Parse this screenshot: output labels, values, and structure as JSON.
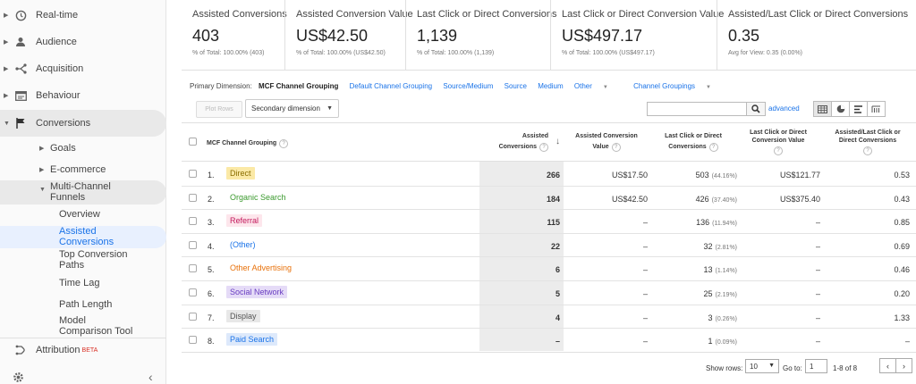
{
  "sidebar": {
    "realtime": "Real-time",
    "audience": "Audience",
    "acquisition": "Acquisition",
    "behaviour": "Behaviour",
    "conversions": "Conversions",
    "goals": "Goals",
    "ecommerce": "E-commerce",
    "mcf": "Multi-Channel Funnels",
    "overview": "Overview",
    "assisted": "Assisted Conversions",
    "top_paths": "Top Conversion Paths",
    "time_lag": "Time Lag",
    "path_length": "Path Length",
    "model_comparison": "Model Comparison Tool",
    "attribution": "Attribution",
    "attribution_badge": "BETA"
  },
  "scorecards": [
    {
      "label": "Assisted Conversions",
      "value": "403",
      "sub": "% of Total: 100.00% (403)"
    },
    {
      "label": "Assisted Conversion Value",
      "value": "US$42.50",
      "sub": "% of Total: 100.00% (US$42.50)"
    },
    {
      "label": "Last Click or Direct Conversions",
      "value": "1,139",
      "sub": "% of Total: 100.00% (1,139)"
    },
    {
      "label": "Last Click or Direct Conversion Value",
      "value": "US$497.17",
      "sub": "% of Total: 100.00% (US$497.17)"
    },
    {
      "label": "Assisted/Last Click or Direct Conversions",
      "value": "0.35",
      "sub": "Avg for View: 0.35 (0.00%)"
    }
  ],
  "dimensions": {
    "label": "Primary Dimension:",
    "current": "MCF Channel Grouping",
    "links": [
      "Default Channel Grouping",
      "Source/Medium",
      "Source",
      "Medium"
    ],
    "other": "Other",
    "channel_groupings": "Channel Groupings"
  },
  "toolbar": {
    "plot_rows": "Plot Rows",
    "secondary_dimension": "Secondary dimension",
    "advanced": "advanced"
  },
  "table": {
    "headers": {
      "channel": "MCF Channel Grouping",
      "assisted_conv_1": "Assisted",
      "assisted_conv_2": "Conversions",
      "assisted_value_1": "Assisted Conversion",
      "assisted_value_2": "Value",
      "last_click_1": "Last Click or Direct",
      "last_click_2": "Conversions",
      "last_value_1": "Last Click or Direct",
      "last_value_2": "Conversion Value",
      "ratio_1": "Assisted/Last Click or",
      "ratio_2": "Direct Conversions"
    },
    "rows": [
      {
        "num": "1.",
        "channel": "Direct",
        "chip_bg": "#fbe9a6",
        "chip_fg": "#8a6d00",
        "assisted": "266",
        "assisted_value": "US$17.50",
        "last_click": "503",
        "last_click_pct": "(44.16%)",
        "last_value": "US$121.77",
        "ratio": "0.53"
      },
      {
        "num": "2.",
        "channel": "Organic Search",
        "chip_bg": "#ffffff",
        "chip_fg": "#3b9a2e",
        "assisted": "184",
        "assisted_value": "US$42.50",
        "last_click": "426",
        "last_click_pct": "(37.40%)",
        "last_value": "US$375.40",
        "ratio": "0.43"
      },
      {
        "num": "3.",
        "channel": "Referral",
        "chip_bg": "#fde6ec",
        "chip_fg": "#c2185b",
        "assisted": "115",
        "assisted_value": "–",
        "last_click": "136",
        "last_click_pct": "(11.94%)",
        "last_value": "–",
        "ratio": "0.85"
      },
      {
        "num": "4.",
        "channel": "(Other)",
        "chip_bg": "#ffffff",
        "chip_fg": "#1a73e8",
        "assisted": "22",
        "assisted_value": "–",
        "last_click": "32",
        "last_click_pct": "(2.81%)",
        "last_value": "–",
        "ratio": "0.69"
      },
      {
        "num": "5.",
        "channel": "Other Advertising",
        "chip_bg": "#ffffff",
        "chip_fg": "#e8710a",
        "assisted": "6",
        "assisted_value": "–",
        "last_click": "13",
        "last_click_pct": "(1.14%)",
        "last_value": "–",
        "ratio": "0.46"
      },
      {
        "num": "6.",
        "channel": "Social Network",
        "chip_bg": "#e5dbf7",
        "chip_fg": "#6a3ec2",
        "assisted": "5",
        "assisted_value": "–",
        "last_click": "25",
        "last_click_pct": "(2.19%)",
        "last_value": "–",
        "ratio": "0.20"
      },
      {
        "num": "7.",
        "channel": "Display",
        "chip_bg": "#e8e8e8",
        "chip_fg": "#555555",
        "assisted": "4",
        "assisted_value": "–",
        "last_click": "3",
        "last_click_pct": "(0.26%)",
        "last_value": "–",
        "ratio": "1.33"
      },
      {
        "num": "8.",
        "channel": "Paid Search",
        "chip_bg": "#dde9fb",
        "chip_fg": "#1a73e8",
        "assisted": "–",
        "assisted_value": "–",
        "last_click": "1",
        "last_click_pct": "(0.09%)",
        "last_value": "–",
        "ratio": "–"
      }
    ]
  },
  "footer": {
    "show_rows": "Show rows:",
    "rows_value": "10",
    "goto": "Go to:",
    "goto_value": "1",
    "range": "1-8 of 8",
    "prev": "‹",
    "next": "›"
  }
}
